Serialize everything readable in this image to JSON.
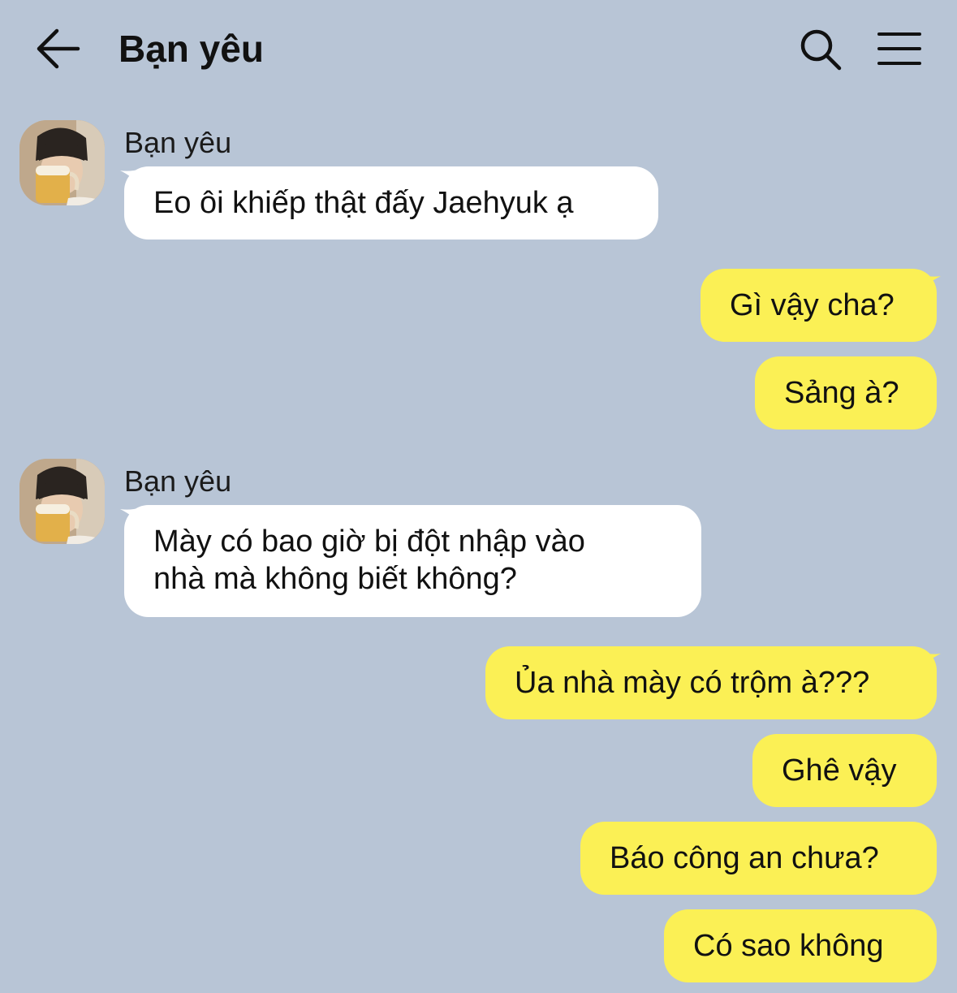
{
  "header": {
    "title": "Bạn yêu",
    "back_icon": "arrow-left-icon",
    "search_icon": "search-icon",
    "menu_icon": "hamburger-menu-icon"
  },
  "colors": {
    "background": "#b8c5d6",
    "incoming_bubble": "#ffffff",
    "outgoing_bubble": "#fbf055"
  },
  "messages": [
    {
      "direction": "in",
      "sender": "Bạn yêu",
      "text": "Eo ôi khiếp thật đấy Jaehyuk ạ"
    },
    {
      "direction": "out",
      "text": "Gì vậy cha?"
    },
    {
      "direction": "out",
      "text": "Sảng à?"
    },
    {
      "direction": "in",
      "sender": "Bạn yêu",
      "text_line1": "Mày có bao giờ bị đột nhập vào",
      "text_line2": "nhà mà không biết không?"
    },
    {
      "direction": "out",
      "text": "Ủa nhà mày có trộm à???"
    },
    {
      "direction": "out",
      "text": "Ghê vậy"
    },
    {
      "direction": "out",
      "text": "Báo công an chưa?"
    },
    {
      "direction": "out",
      "text": "Có sao không"
    }
  ]
}
